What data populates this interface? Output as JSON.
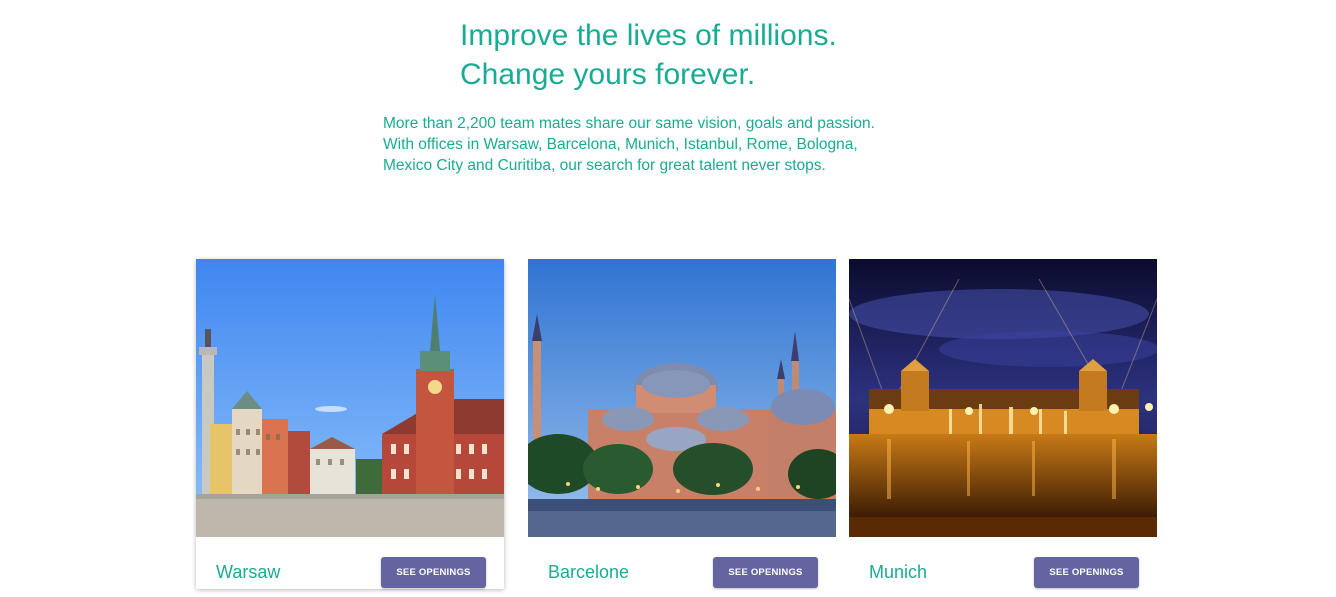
{
  "header": {
    "headline_line1": "Improve the lives of millions.",
    "headline_line2": "Change yours forever.",
    "intro_line1": "More than 2,200 team mates share our same vision, goals and passion.",
    "intro_line2": "With offices in Warsaw, Barcelona, Munich, Istanbul, Rome, Bologna,",
    "intro_line3": "Mexico City and Curitiba, our search for great talent never stops."
  },
  "cards": [
    {
      "city": "Warsaw",
      "button_label": "SEE OPENINGS",
      "image_icon": "warsaw-castle-square-photo"
    },
    {
      "city": "Barcelone",
      "button_label": "SEE OPENINGS",
      "image_icon": "mosque-domes-photo"
    },
    {
      "city": "Munich",
      "button_label": "SEE OPENINGS",
      "image_icon": "palace-fountain-night-photo"
    }
  ],
  "colors": {
    "accent_text": "#1aab93",
    "button_bg": "#6465a0",
    "button_text": "#ffffff"
  }
}
